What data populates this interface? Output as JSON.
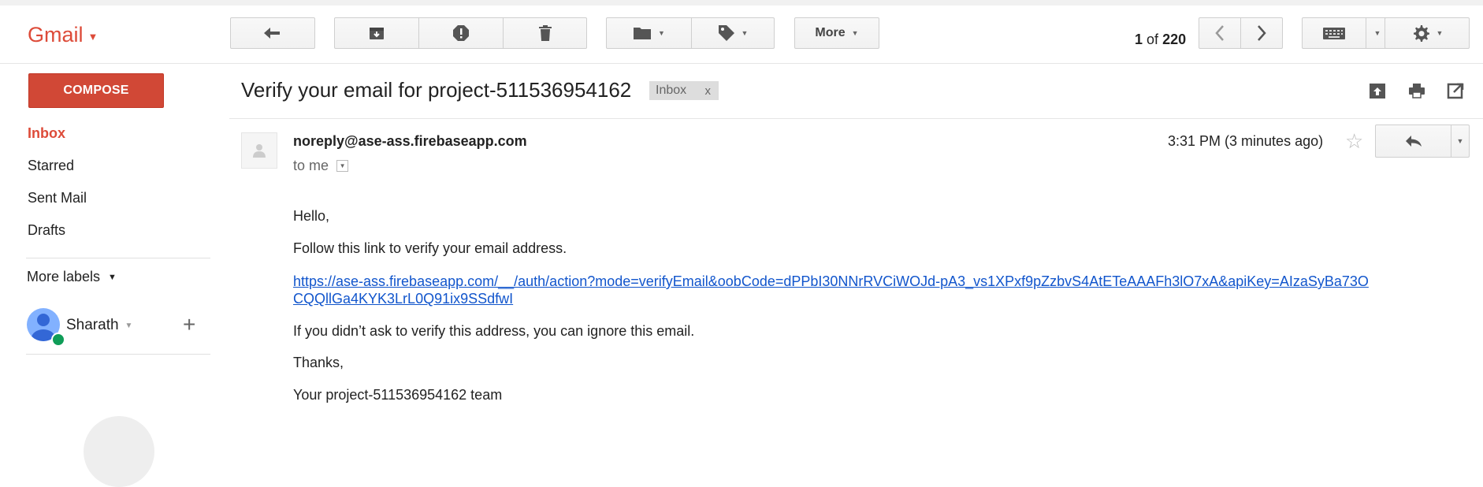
{
  "app": {
    "logo": "Gmail"
  },
  "toolbar": {
    "more_label": "More",
    "pager": {
      "current": "1",
      "of": "of",
      "total": "220"
    }
  },
  "sidebar": {
    "compose_label": "COMPOSE",
    "items": [
      {
        "label": "Inbox",
        "active": true
      },
      {
        "label": "Starred"
      },
      {
        "label": "Sent Mail"
      },
      {
        "label": "Drafts"
      }
    ],
    "more_labels": "More labels",
    "user_name": "Sharath",
    "add_symbol": "+"
  },
  "email": {
    "subject": "Verify your email for project-511536954162",
    "label_chip": "Inbox",
    "label_remove": "x",
    "sender": "noreply@ase-ass.firebaseapp.com",
    "to_me": "to me",
    "timestamp": "3:31 PM (3 minutes ago)",
    "star": "☆",
    "body": {
      "greeting": "Hello,",
      "instruction": "Follow this link to verify your email address.",
      "link": "https://ase-ass.firebaseapp.com/__/auth/action?mode=verifyEmail&oobCode=dPPbI30NNrRVCiWOJd-pA3_vs1XPxf9pZzbvS4AtETeAAAFh3lO7xA&apiKey=AIzaSyBa73OCQQllGa4KYK3LrL0Q91ix9SSdfwI",
      "ignore": "If you didn’t ask to verify this address, you can ignore this email.",
      "thanks": "Thanks,",
      "signature": "Your project-511536954162 team"
    }
  },
  "icons": {
    "reply": "reply-arrow-icon",
    "archive": "archive-icon",
    "spam": "report-spam-icon",
    "delete": "trash-icon",
    "move": "folder-icon",
    "labels": "tag-icon",
    "prev": "chevron-left-icon",
    "next": "chevron-right-icon",
    "keyboard": "keyboard-icon",
    "settings": "gear-icon"
  },
  "colors": {
    "brand_red": "#dd4b39",
    "compose_red": "#d14836",
    "link_blue": "#1155cc"
  }
}
